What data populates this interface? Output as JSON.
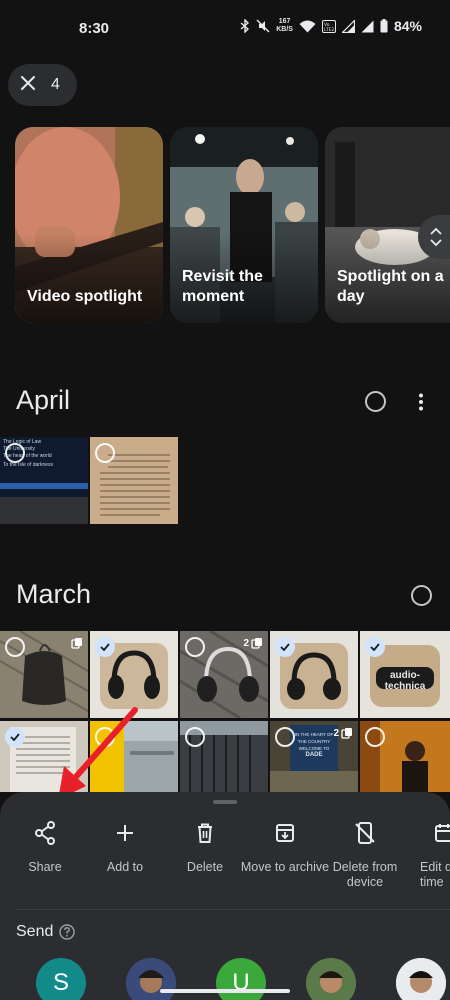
{
  "status_bar": {
    "time": "8:30",
    "net_speed_value": "167",
    "net_speed_unit": "KB/S",
    "volte": "Vo LTE 2",
    "battery": "84%"
  },
  "selection": {
    "count": "4",
    "close_icon": "close-icon"
  },
  "memories": [
    {
      "title": "Video spotlight"
    },
    {
      "title": "Revisit the moment"
    },
    {
      "title": "Spotlight on a day"
    }
  ],
  "sections": {
    "april": {
      "title": "April"
    },
    "march": {
      "title": "March"
    }
  },
  "thumbnails": {
    "april": [
      {
        "overlay_lines": [
          "The Logic of Law",
          "The University",
          "The heart of the world",
          "To the Isle of darkness"
        ]
      },
      {}
    ],
    "march": [
      {
        "selected": false,
        "stack": ""
      },
      {
        "selected": true,
        "stack": ""
      },
      {
        "selected": false,
        "stack": "2"
      },
      {
        "selected": true,
        "stack": ""
      },
      {
        "selected": true,
        "stack": "",
        "brand_text": "audio-technica"
      },
      {
        "selected": true,
        "stack": ""
      },
      {
        "selected": false,
        "stack": ""
      },
      {
        "selected": false,
        "stack": ""
      },
      {
        "selected": false,
        "stack": "2",
        "sign_lines": [
          "IN THE HEART OF",
          "THE COUNTRY",
          "WELCOME TO",
          "DADE"
        ]
      },
      {
        "selected": false,
        "stack": ""
      }
    ]
  },
  "sheet": {
    "actions": [
      {
        "label": "Share",
        "icon": "share-icon"
      },
      {
        "label": "Add to",
        "icon": "add-icon"
      },
      {
        "label": "Delete",
        "icon": "trash-icon"
      },
      {
        "label": "Move to archive",
        "icon": "archive-icon"
      },
      {
        "label": "Delete from device",
        "icon": "phone-off-icon"
      },
      {
        "label": "Edit date and time",
        "icon": "calendar-icon"
      }
    ],
    "send_label": "Send",
    "contacts": [
      {
        "initial": "S",
        "color": "#128a8a"
      },
      {
        "initial": "",
        "color": "#4a5a8a"
      },
      {
        "initial": "U",
        "color": "#3aa83a"
      },
      {
        "initial": "",
        "color": "#4a6a3a"
      },
      {
        "initial": "",
        "color": "#dfe3e8"
      }
    ]
  },
  "colors": {
    "background": "#121212",
    "sheet": "#2b2d31",
    "accent_check": "#d2e3fc",
    "annotation_arrow": "#e8202a"
  }
}
